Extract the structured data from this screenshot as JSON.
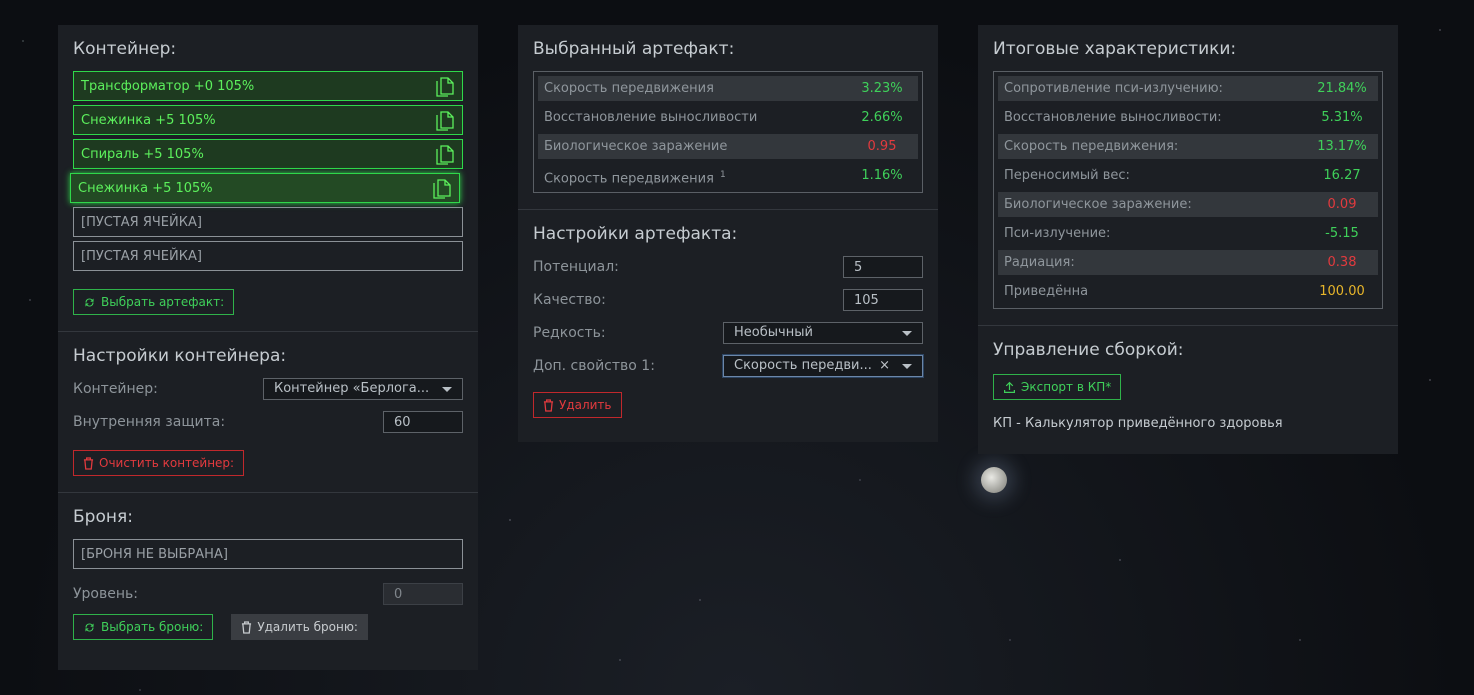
{
  "container_panel": {
    "title": "Контейнер:",
    "slots": [
      {
        "label": "Трансформатор +0 105%",
        "filled": true
      },
      {
        "label": "Снежинка +5 105%",
        "filled": true
      },
      {
        "label": "Спираль +5 105%",
        "filled": true
      },
      {
        "label": "Снежинка +5 105%",
        "filled": true,
        "active": true
      },
      {
        "label": "[ПУСТАЯ ЯЧЕЙКА]",
        "filled": false
      },
      {
        "label": "[ПУСТАЯ ЯЧЕЙКА]",
        "filled": false
      }
    ],
    "choose_artifact_label": "Выбрать артефакт:"
  },
  "container_settings": {
    "title": "Настройки контейнера:",
    "container_label": "Контейнер:",
    "container_value": "Контейнер «Берлога...",
    "inner_protection_label": "Внутренняя защита:",
    "inner_protection_value": "60",
    "clear_label": "Очистить контейнер:"
  },
  "armor": {
    "title": "Броня:",
    "value": "[БРОНЯ НЕ ВЫБРАНА]",
    "level_label": "Уровень:",
    "level_value": "0",
    "choose_label": "Выбрать броню:",
    "delete_label": "Удалить броню:"
  },
  "selected_artifact": {
    "title": "Выбранный артефакт:",
    "stats": [
      {
        "name": "Скорость передвижения",
        "value": "3.23%",
        "color": "green",
        "dark": true
      },
      {
        "name": "Восстановление выносливости",
        "value": "2.66%",
        "color": "green",
        "dark": false
      },
      {
        "name": "Биологическое заражение",
        "value": "0.95",
        "color": "red",
        "dark": true
      },
      {
        "name": "Скорость передвижения",
        "sup": "1",
        "value": "1.16%",
        "color": "green",
        "dark": false
      }
    ]
  },
  "artifact_settings": {
    "title": "Настройки артефакта:",
    "potential_label": "Потенциал:",
    "potential_value": "5",
    "quality_label": "Качество:",
    "quality_value": "105",
    "rarity_label": "Редкость:",
    "rarity_value": "Необычный",
    "extra_label": "Доп. свойство 1:",
    "extra_value": "Скорость передви...",
    "delete_label": "Удалить"
  },
  "totals": {
    "title": "Итоговые характеристики:",
    "stats": [
      {
        "name": "Сопротивление пси-излучению:",
        "value": "21.84%",
        "color": "green",
        "dark": true
      },
      {
        "name": "Восстановление выносливости:",
        "value": "5.31%",
        "color": "green",
        "dark": false
      },
      {
        "name": "Скорость передвижения:",
        "value": "13.17%",
        "color": "green",
        "dark": true
      },
      {
        "name": "Переносимый вес:",
        "value": "16.27",
        "color": "green",
        "dark": false
      },
      {
        "name": "Биологическое заражение:",
        "value": "0.09",
        "color": "red",
        "dark": true
      },
      {
        "name": "Пси-излучение:",
        "value": "-5.15",
        "color": "green",
        "dark": false
      },
      {
        "name": "Радиация:",
        "value": "0.38",
        "color": "red",
        "dark": true
      },
      {
        "name": "Приведённа",
        "value": "100.00",
        "color": "yellow",
        "dark": false
      }
    ]
  },
  "build": {
    "title": "Управление сборкой:",
    "export_label": "Экспорт в КП*",
    "note": "КП - Калькулятор приведённого здоровья"
  },
  "icons": {
    "slot": "copy-icon",
    "choose": "refresh-icon",
    "delete": "trash-icon",
    "export": "upload-icon"
  },
  "colors": {
    "green": "#3fd05a",
    "red": "#e23a3e",
    "yellow": "#e7b52a",
    "panel": "#1c1f24"
  }
}
